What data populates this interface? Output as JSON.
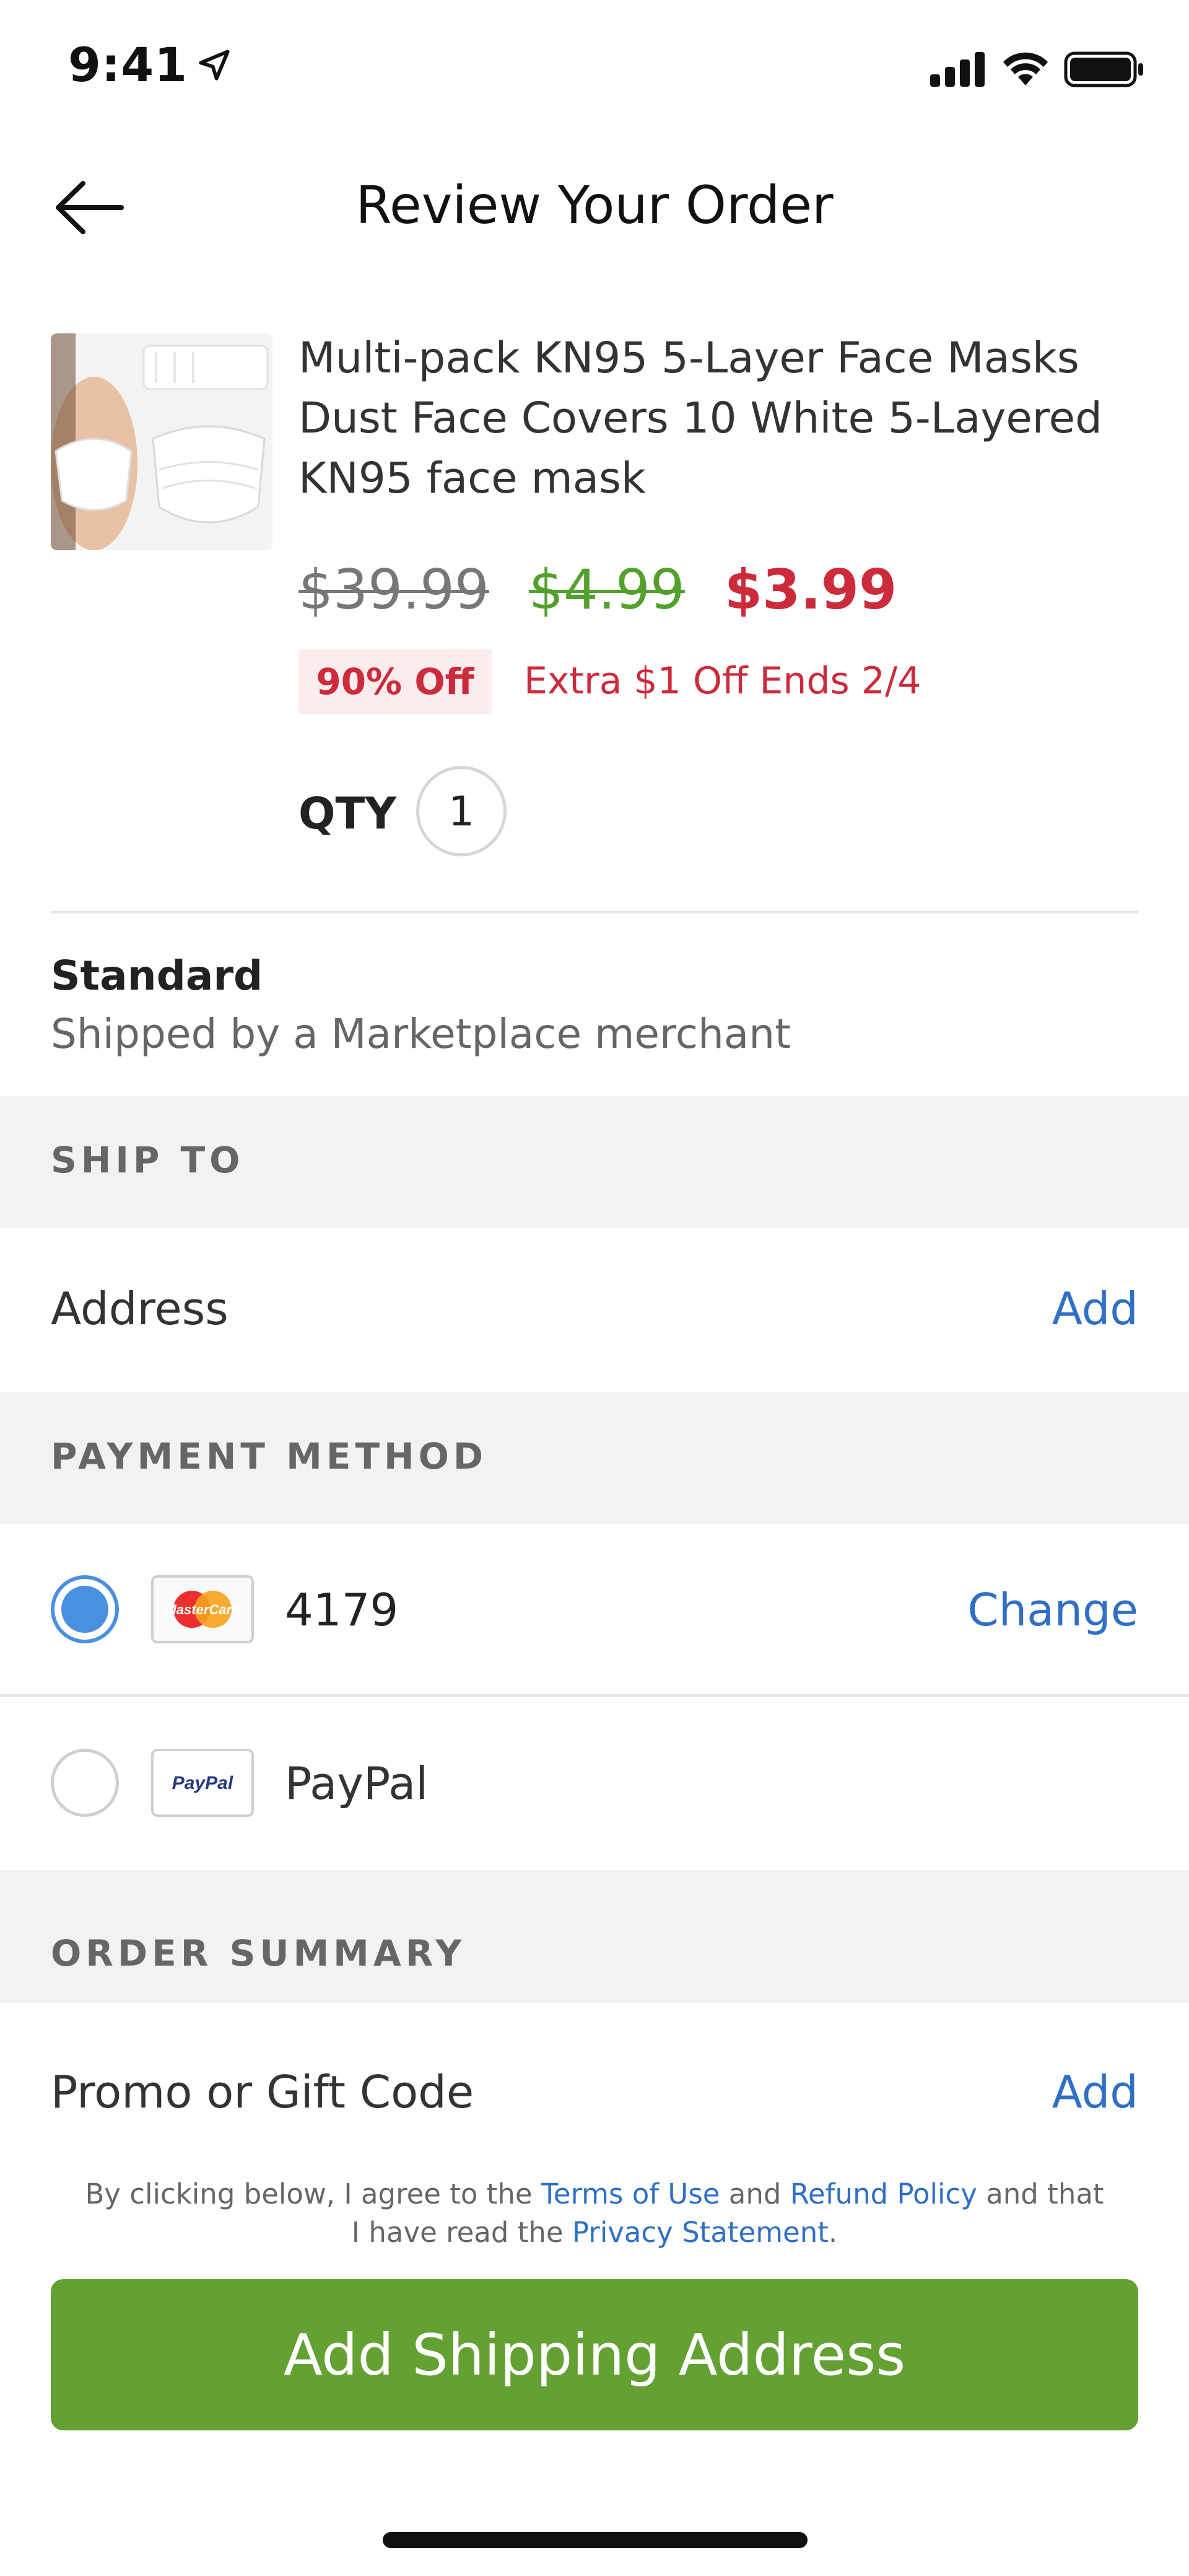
{
  "status_bar": {
    "time": "9:41"
  },
  "header": {
    "title": "Review Your Order"
  },
  "product": {
    "title": "Multi-pack KN95 5-Layer Face Masks Dust Face Covers  10 White 5-Layered KN95 face mask",
    "price_original": "$39.99",
    "price_sale": "$4.99",
    "price_final": "$3.99",
    "discount_badge": "90% Off",
    "promo_text": "Extra $1 Off Ends 2/4",
    "qty_label": "QTY",
    "qty_value": "1"
  },
  "shipping": {
    "method": "Standard",
    "subtitle": "Shipped by a Marketplace merchant"
  },
  "ship_to": {
    "section_label": "SHIP TO",
    "address_label": "Address",
    "add_link": "Add"
  },
  "payment": {
    "section_label": "PAYMENT METHOD",
    "card": {
      "last4": "4179",
      "brand_icon_text": "MasterCard",
      "change_link": "Change",
      "selected": true
    },
    "paypal": {
      "label": "PayPal",
      "brand_icon_text": "PayPal",
      "selected": false
    }
  },
  "order_summary": {
    "section_label": "ORDER SUMMARY",
    "promo_label": "Promo or Gift Code",
    "add_link": "Add"
  },
  "legal": {
    "prefix": "By clicking below, I agree to the ",
    "terms_link": "Terms of Use",
    "and": " and ",
    "refund_link": "Refund Policy",
    "middle": " and that I have read the ",
    "privacy_link": "Privacy Statement",
    "suffix": "."
  },
  "cta": {
    "label": "Add Shipping Address"
  },
  "colors": {
    "accent_blue": "#2f6fc5",
    "radio_blue": "#4a90e2",
    "sale_green": "#53a02c",
    "price_red": "#cc2b3c",
    "cta_green": "#64a133",
    "band_gray": "#f2f2f3"
  },
  "icons": {
    "back": "arrow-left-icon",
    "location": "location-arrow-icon",
    "signal": "cellular-signal-icon",
    "wifi": "wifi-icon",
    "battery": "battery-icon"
  }
}
